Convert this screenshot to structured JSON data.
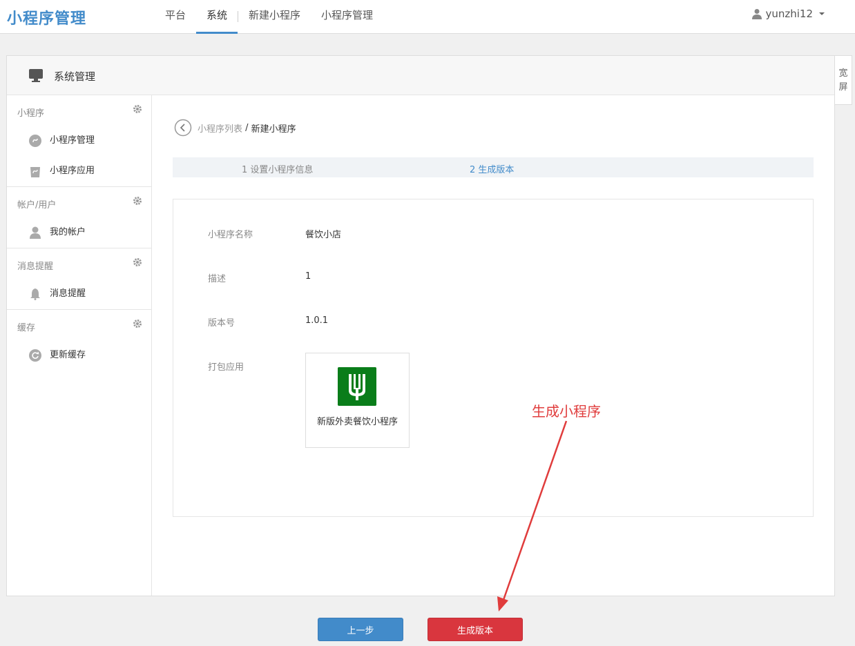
{
  "brand": "小程序管理",
  "nav": [
    {
      "label": "平台",
      "active": false
    },
    {
      "label": "系统",
      "active": true
    },
    {
      "label": "新建小程序",
      "active": false
    },
    {
      "label": "小程序管理",
      "active": false
    }
  ],
  "user": {
    "name": "yunzhi12"
  },
  "panel": {
    "title": "系统管理"
  },
  "side_tab": {
    "line1": "宽",
    "line2": "屏"
  },
  "sidebar": {
    "groups": [
      {
        "title": "小程序",
        "items": [
          {
            "label": "小程序管理",
            "icon": "mini-program-icon"
          },
          {
            "label": "小程序应用",
            "icon": "app-bag-icon"
          }
        ]
      },
      {
        "title": "帐户/用户",
        "items": [
          {
            "label": "我的帐户",
            "icon": "user-icon"
          }
        ]
      },
      {
        "title": "消息提醒",
        "items": [
          {
            "label": "消息提醒",
            "icon": "bell-icon"
          }
        ]
      },
      {
        "title": "缓存",
        "items": [
          {
            "label": "更新缓存",
            "icon": "refresh-icon"
          }
        ]
      }
    ]
  },
  "breadcrumb": {
    "parent": "小程序列表",
    "separator": " / ",
    "current": "新建小程序"
  },
  "steps": {
    "step1": "1 设置小程序信息",
    "step2": "2 生成版本"
  },
  "info": {
    "name_label": "小程序名称",
    "name_value": "餐饮小店",
    "desc_label": "描述",
    "desc_value": "1",
    "version_label": "版本号",
    "version_value": "1.0.1",
    "package_label": "打包应用",
    "app_name": "新版外卖餐饮小程序"
  },
  "annotation": "生成小程序",
  "buttons": {
    "prev": "上一步",
    "generate": "生成版本"
  },
  "colors": {
    "accent": "#428bca",
    "danger": "#d9363e",
    "app_logo": "#0a7d1a",
    "annotation": "#e03c3c"
  }
}
